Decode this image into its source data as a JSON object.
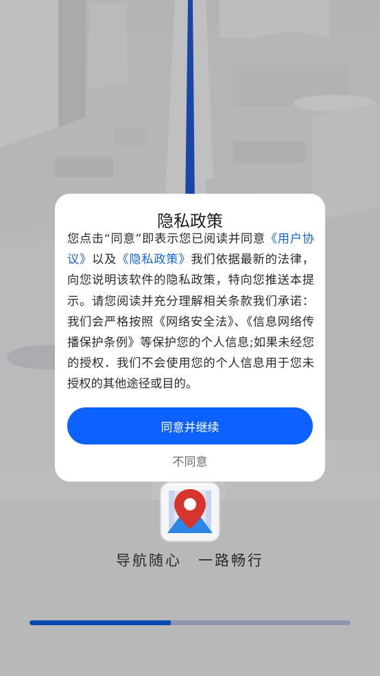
{
  "dialog": {
    "title": "隐私政策",
    "body": {
      "intro": "您点击“同意”即表示您已阅读并同意",
      "user_agreement_link": "《用户协议》",
      "connector": "以及",
      "privacy_policy_link": "《隐私政策》",
      "rest": "我们依据最新的法律，向您说明该软件的隐私政策，特向您推送本提示。请您阅读并充分理解相关条款我们承诺：我们会严格按照《网络安全法》、《信息网络传播保护条例》等保护您的个人信息;如果未经您的授权．我们不会使用您的个人信息用于您未授权的其他途径或目的。"
    },
    "agree_button": "同意并继续",
    "disagree_button": "不同意"
  },
  "splash": {
    "logo_icon": "map-pin-icon",
    "slogan": "导航随心　一路畅行",
    "progress": 0.44
  },
  "colors": {
    "accent": "#0d61fe",
    "link": "#1766d6",
    "progress_fill": "#0a48b4",
    "progress_track": "#8c97ad",
    "pin": "#d5352c",
    "route": "#1f5bd6"
  }
}
